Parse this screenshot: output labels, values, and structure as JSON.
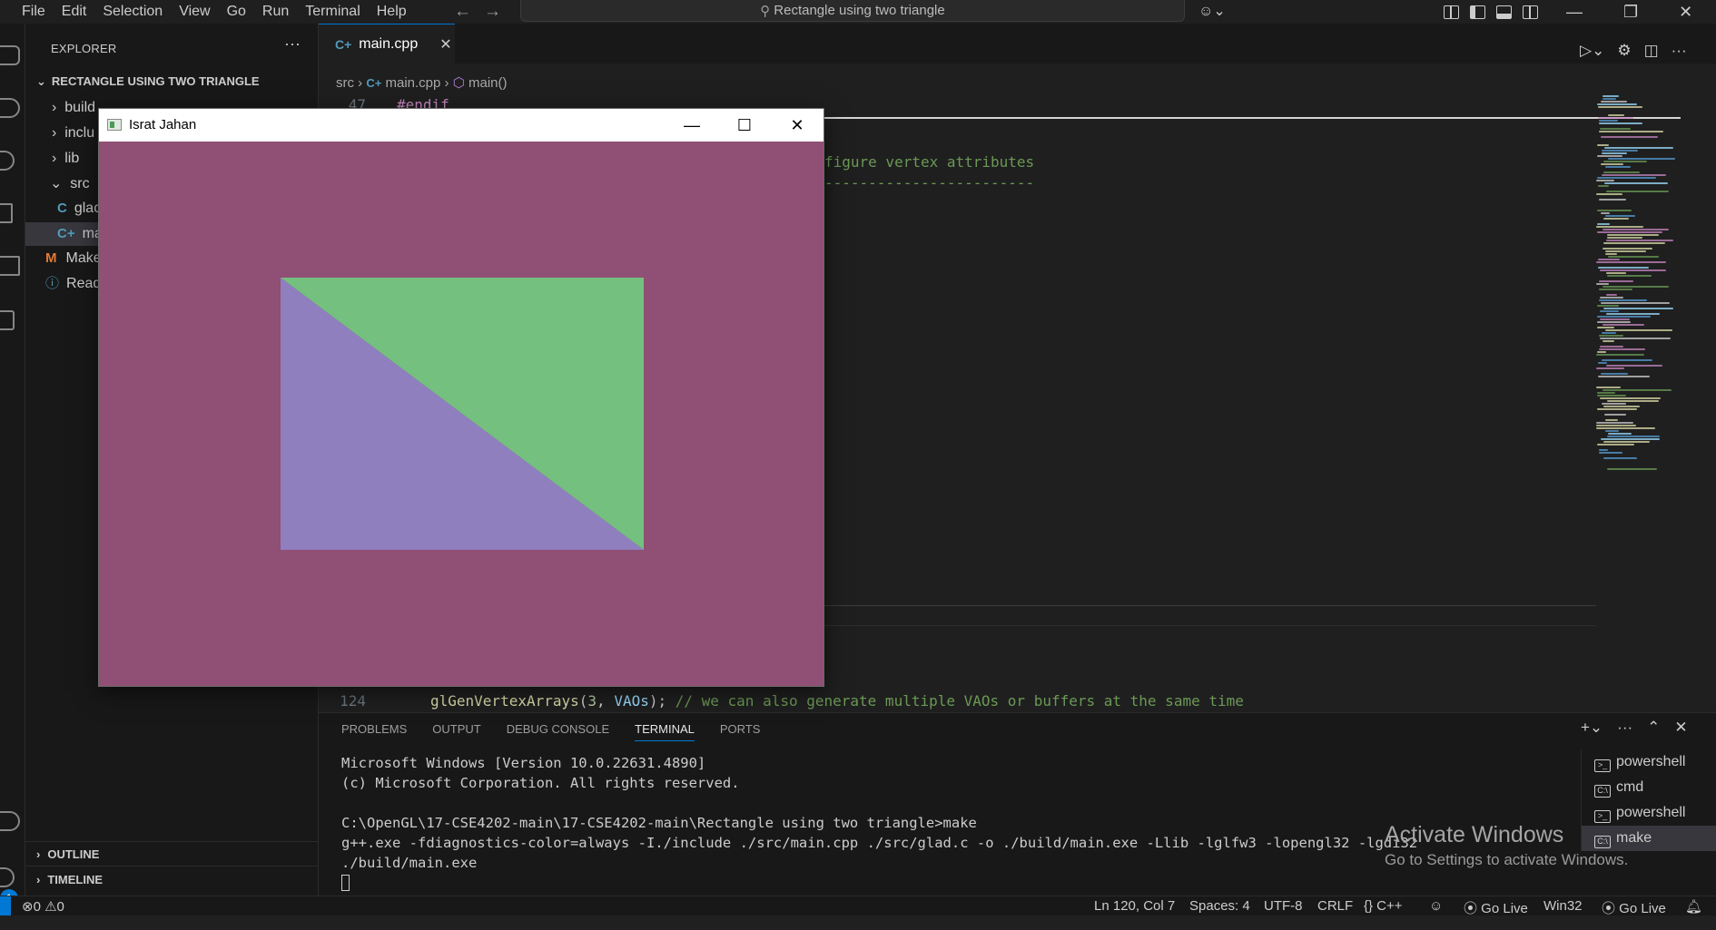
{
  "menu": [
    "File",
    "Edit",
    "Selection",
    "View",
    "Go",
    "Run",
    "Terminal",
    "Help"
  ],
  "search": {
    "text": "Rectangle using two triangle"
  },
  "explorer": {
    "header": "EXPLORER",
    "more": "···",
    "project": "RECTANGLE USING TWO TRIANGLE",
    "items": [
      {
        "label": "build"
      },
      {
        "label": "inclu"
      },
      {
        "label": "lib"
      },
      {
        "label": "src"
      },
      {
        "label": "glac"
      },
      {
        "label": "mai"
      },
      {
        "label": "Make"
      },
      {
        "label": "Read"
      }
    ],
    "outline": "OUTLINE",
    "timeline": "TIMELINE"
  },
  "editor": {
    "tab_label": "main.cpp",
    "breadcrumb": {
      "folder": "src",
      "file": "main.cpp",
      "symbol": "main()"
    },
    "lines": [
      {
        "no": "47",
        "text": "#endif"
      },
      {
        "no": "",
        "text": "figure vertex attributes"
      },
      {
        "no": "",
        "text": "------------------------"
      },
      {
        "no": "124",
        "fn": "glGenVertexArrays",
        "args_open": "(",
        "num": "3",
        "sep": ", ",
        "var": "VAOs",
        "args_close": ");",
        "comment": " // we can also generate multiple VAOs or buffers at the same time"
      }
    ]
  },
  "panel": {
    "tabs": [
      "PROBLEMS",
      "OUTPUT",
      "DEBUG CONSOLE",
      "TERMINAL",
      "PORTS"
    ],
    "active_tab": "TERMINAL",
    "terminal_lines": [
      "Microsoft Windows [Version 10.0.22631.4890]",
      "(c) Microsoft Corporation. All rights reserved.",
      "",
      "C:\\OpenGL\\17-CSE4202-main\\17-CSE4202-main\\Rectangle using two triangle>make",
      "g++.exe -fdiagnostics-color=always -I./include ./src/main.cpp ./src/glad.c -o ./build/main.exe -Llib -lglfw3 -lopengl32 -lgdi32",
      "./build/main.exe"
    ],
    "terminals": [
      "powershell",
      "cmd",
      "powershell",
      "make"
    ],
    "selected_terminal": "make"
  },
  "watermark": {
    "title": "Activate Windows",
    "subtitle": "Go to Settings to activate Windows."
  },
  "status": {
    "errors": "0",
    "warnings": "0",
    "position": "Ln 120, Col 7",
    "spaces": "Spaces: 4",
    "encoding": "UTF-8",
    "eol": "CRLF",
    "language": "{} C++",
    "golive1": "Go Live",
    "platform": "Win32",
    "golive2": "Go Live",
    "badge": "1"
  },
  "gl_window": {
    "title": "Israt Jahan",
    "colors": {
      "background": "#904f74",
      "triangle_top_right": "#74c07e",
      "triangle_bottom_left": "#8f7fbf"
    }
  },
  "colors": {
    "accent": "#0078d4",
    "editor_bg": "#1f1f1f",
    "sidebar_bg": "#181818"
  }
}
